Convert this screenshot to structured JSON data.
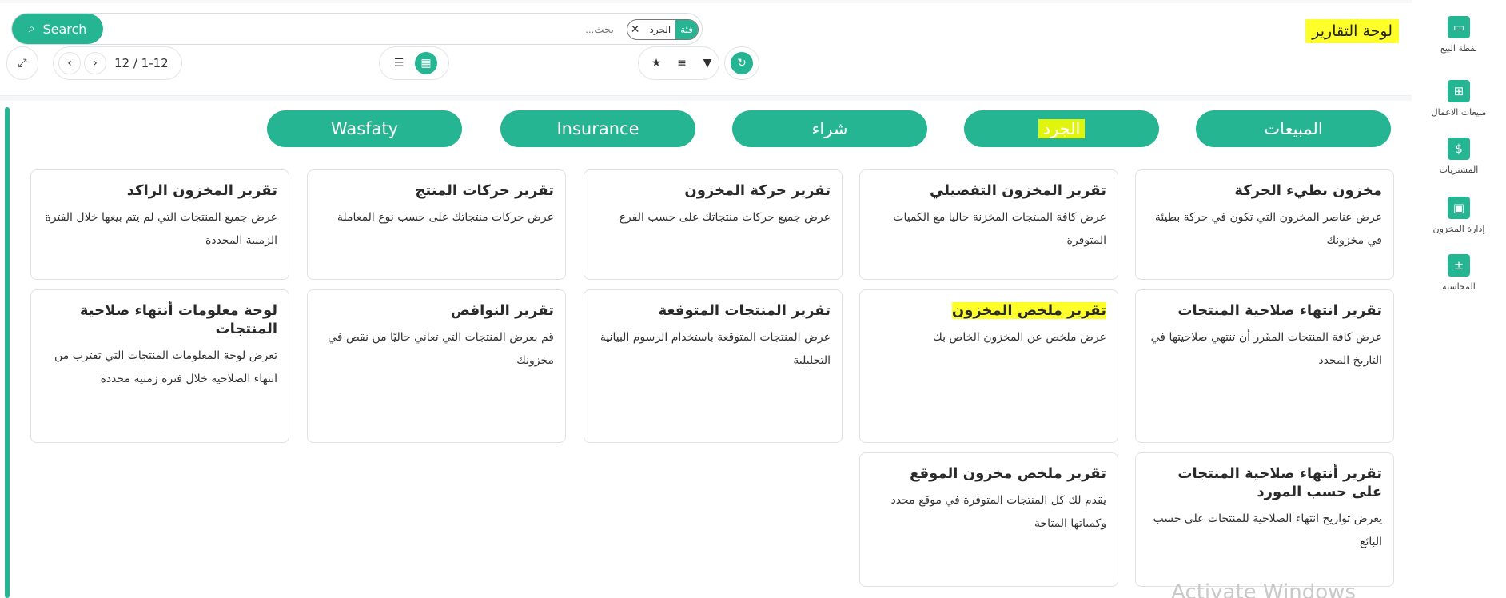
{
  "title": "لوحة التقارير",
  "sidebar": {
    "items": [
      {
        "label": "نقطة البيع",
        "icon": "monitor-icon"
      },
      {
        "label": "مبيعات الاعمال",
        "icon": "business-sales-icon"
      },
      {
        "label": "المشتريات",
        "icon": "dollar-icon"
      },
      {
        "label": "إدارة المخزون",
        "icon": "inventory-box-icon"
      },
      {
        "label": "المحاسبة",
        "icon": "calculator-icon"
      }
    ]
  },
  "search": {
    "button_label": "Search",
    "placeholder": "بحث...",
    "facet_label": "فئة",
    "facet_value": "الجرد"
  },
  "pager": {
    "text": "12 / 1-12"
  },
  "categories": [
    {
      "label": "المبيعات"
    },
    {
      "label": "الجرد"
    },
    {
      "label": "شراء"
    },
    {
      "label": "Insurance"
    },
    {
      "label": "Wasfaty"
    }
  ],
  "cards": [
    {
      "title": "مخزون بطيء الحركة",
      "desc": "عرض عناصر المخزون التي تكون في حركة بطيئة في مخزونك"
    },
    {
      "title": "تقرير المخزون التفصيلي",
      "desc": "عرض كافة المنتجات المخزنة حاليا مع الكميات المتوفرة"
    },
    {
      "title": "تقرير حركة المخزون",
      "desc": "عرض جميع حركات منتجاتك على حسب الفرع"
    },
    {
      "title": "تقرير حركات المنتج",
      "desc": "عرض حركات منتجاتك على حسب نوع المعاملة"
    },
    {
      "title": "تقرير المخزون الراكد",
      "desc": "عرض جميع المنتجات التي لم يتم بيعها خلال الفترة الزمنية المحددة"
    },
    {
      "title": "تقرير انتهاء صلاحية المنتجات",
      "desc": "عرض كافة المنتجات المقَرر أن تنتهي صلاحيتها في التاريخ المحدد"
    },
    {
      "title": "تقرير ملخص المخزون",
      "desc": "عرض ملخص عن المخزون الخاص بك"
    },
    {
      "title": "تقرير المنتجات المتوقعة",
      "desc": "عرض المنتجات المتوقعة باستخدام الرسوم البيانية التحليلية"
    },
    {
      "title": "تقرير النواقص",
      "desc": "قم بعرض المنتجات التي تعاني حاليًا من نقص في مخزونك"
    },
    {
      "title": "لوحة معلومات أنتهاء صلاحية المنتجات",
      "desc": "تعرض لوحة المعلومات المنتجات التي تقترب من انتهاء الصلاحية خلال فترة زمنية محددة"
    },
    {
      "title": "تقرير أنتهاء صلاحية المنتجات على حسب المورد",
      "desc": "يعرض تواريخ انتهاء الصلاحية للمنتجات على حسب البائع"
    },
    {
      "title": "تقرير ملخص مخزون الموقع",
      "desc": "يقدم لك كل المنتجات المتوفرة في موقع محدد وكمياتها المتاحة"
    }
  ],
  "watermark": "Activate Windows",
  "colors": {
    "accent": "#26b592",
    "highlight": "#ffff29"
  }
}
